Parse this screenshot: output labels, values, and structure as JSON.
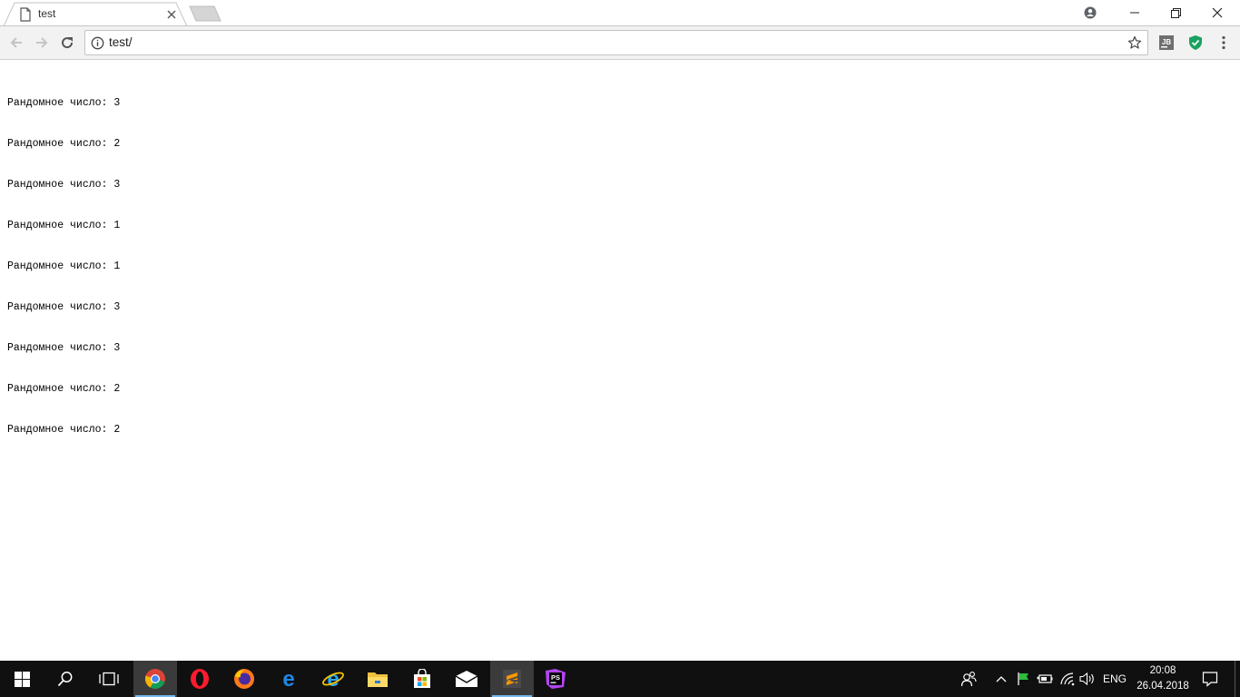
{
  "browser": {
    "tab": {
      "title": "test"
    },
    "address_bar": {
      "url": "test/"
    }
  },
  "page": {
    "lines": [
      "Рандомное число: 3",
      "Рандомное число: 2",
      "Рандомное число: 3",
      "Рандомное число: 1",
      "Рандомное число: 1",
      "Рандомное число: 3",
      "Рандомное число: 3",
      "Рандомное число: 2",
      "Рандомное число: 2"
    ]
  },
  "taskbar": {
    "apps": [
      "chrome-icon",
      "opera-icon",
      "firefox-icon",
      "edge-icon",
      "internet-explorer-icon",
      "file-explorer-icon",
      "store-icon",
      "mail-icon",
      "sublime-text-icon",
      "phpstorm-icon"
    ],
    "language": "ENG",
    "time": "20:08",
    "date": "26.04.2018"
  },
  "colors": {
    "taskbar_bg": "#101010",
    "running_indicator": "#76b9ed",
    "extension_green": "#1aa260"
  }
}
